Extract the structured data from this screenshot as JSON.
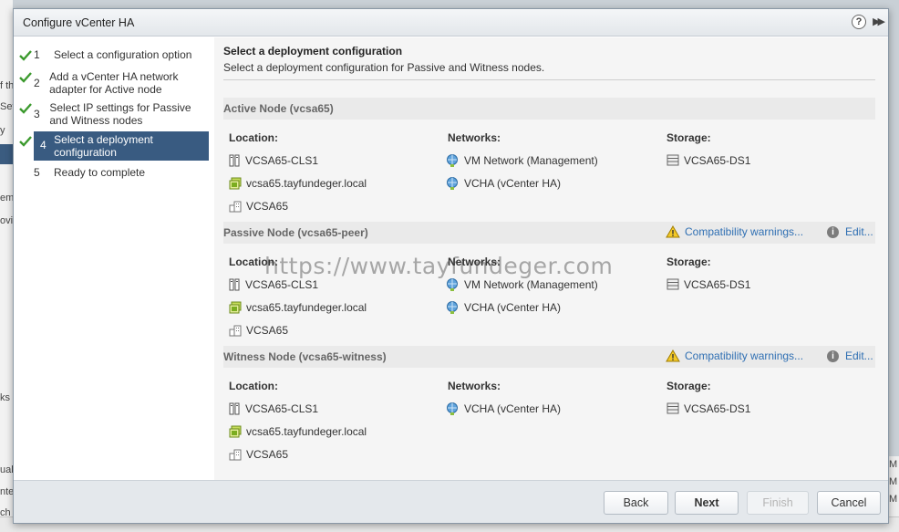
{
  "background": {
    "left_fragments": [
      "f th",
      "Set",
      "y",
      "em",
      "ovi",
      "ks",
      "ual",
      "nte",
      "ch"
    ],
    "right_fragments": [
      "M",
      "M",
      "M"
    ]
  },
  "dialog": {
    "title": "Configure vCenter HA",
    "help_glyph": "?",
    "expand_glyph": "▶▶"
  },
  "steps": [
    {
      "num": "1",
      "label": "Select a configuration option",
      "done": true
    },
    {
      "num": "2",
      "label": "Add a vCenter HA network adapter for Active node",
      "done": true
    },
    {
      "num": "3",
      "label": "Select IP settings for Passive and Witness nodes",
      "done": true
    },
    {
      "num": "4",
      "label": "Select a deployment configuration",
      "done": true,
      "active": true
    },
    {
      "num": "5",
      "label": "Ready to complete",
      "done": false
    }
  ],
  "content": {
    "title": "Select a deployment configuration",
    "subtitle": "Select a deployment configuration for Passive and Witness nodes.",
    "col_headers": {
      "location": "Location:",
      "networks": "Networks:",
      "storage": "Storage:"
    },
    "active": {
      "name": "Active Node (vcsa65)",
      "location": [
        "VCSA65-CLS1",
        "vcsa65.tayfundeger.local",
        "VCSA65"
      ],
      "networks": [
        "VM Network (Management)",
        "VCHA (vCenter HA)"
      ],
      "storage": [
        "VCSA65-DS1"
      ]
    },
    "passive": {
      "name": "Passive Node (vcsa65-peer)",
      "warning": "Compatibility warnings...",
      "edit": "Edit...",
      "location": [
        "VCSA65-CLS1",
        "vcsa65.tayfundeger.local",
        "VCSA65"
      ],
      "networks": [
        "VM Network (Management)",
        "VCHA (vCenter HA)"
      ],
      "storage": [
        "VCSA65-DS1"
      ]
    },
    "witness": {
      "name": "Witness Node (vcsa65-witness)",
      "warning": "Compatibility warnings...",
      "edit": "Edit...",
      "location": [
        "VCSA65-CLS1",
        "vcsa65.tayfundeger.local",
        "VCSA65"
      ],
      "networks": [
        "VCHA (vCenter HA)"
      ],
      "storage": [
        "VCSA65-DS1"
      ]
    },
    "watermark": "https://www.tayfundeger.com"
  },
  "footer": {
    "back": "Back",
    "next": "Next",
    "finish": "Finish",
    "cancel": "Cancel"
  }
}
